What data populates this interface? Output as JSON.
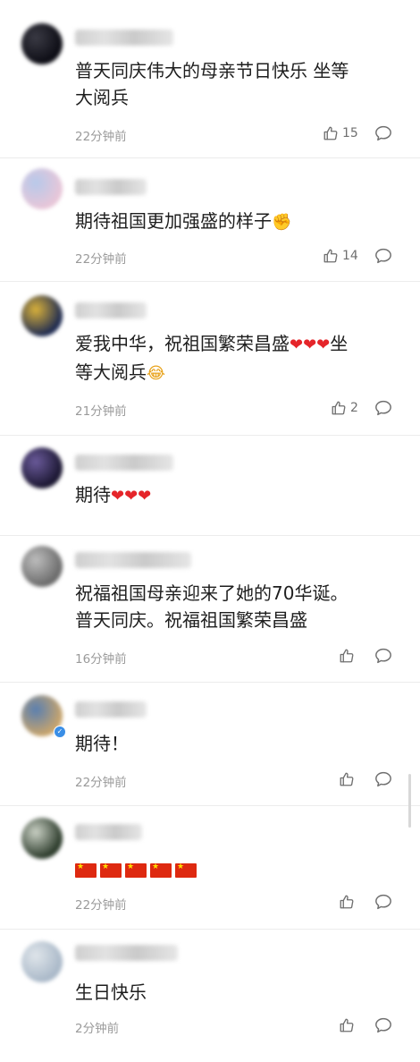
{
  "comments": [
    {
      "text": "普天同庆伟大的母亲节日快乐 坐等\n大阅兵",
      "time": "22分钟前",
      "likes": "15",
      "avatar_colors": [
        "#0c0c14",
        "#3a3a44"
      ],
      "verified": false
    },
    {
      "text": "期待祖国更加强盛的样子",
      "emoji": "✊",
      "time": "22分钟前",
      "likes": "14",
      "avatar_colors": [
        "#e8c6d8",
        "#b7c9ea"
      ],
      "verified": false
    },
    {
      "text": "爱我中华，祝祖国繁荣昌盛",
      "emoji": "❤❤❤",
      "text_after": "坐\n等大阅兵",
      "emoji_after": "😂",
      "time": "21分钟前",
      "likes": "2",
      "avatar_colors": [
        "#1d2a52",
        "#d9b13a"
      ],
      "verified": false
    },
    {
      "text": "期待",
      "emoji": "❤❤❤",
      "time": "",
      "likes": "",
      "avatar_colors": [
        "#1a1630",
        "#6a5a9a"
      ],
      "verified": false
    },
    {
      "text": "祝福祖国母亲迎来了她的70华诞。\n普天同庆。祝福祖国繁荣昌盛",
      "time": "16分钟前",
      "likes": "",
      "avatar_colors": [
        "#6a6a6a",
        "#bdbdbd"
      ],
      "verified": false
    },
    {
      "text": "期待！",
      "time": "22分钟前",
      "likes": "",
      "avatar_colors": [
        "#c9a56c",
        "#5a7fb0"
      ],
      "verified": true
    },
    {
      "text": "",
      "flags": 5,
      "time": "22分钟前",
      "likes": "",
      "avatar_colors": [
        "#2b3a2a",
        "#c9d0c4"
      ],
      "verified": false
    },
    {
      "text": "生日快乐",
      "time": "2分钟前",
      "likes": "",
      "avatar_colors": [
        "#a9b8c8",
        "#dfe5ea"
      ],
      "verified": false
    }
  ],
  "icons": {
    "like": "thumbs-up-icon",
    "reply": "speech-bubble-icon",
    "flag": "china-flag-emoji",
    "heart": "red-heart-emoji",
    "laugh": "laughing-emoji",
    "fist": "fist-emoji"
  },
  "colors": {
    "time": "#9a9a9a",
    "divider": "#ececec",
    "heart": "#e5252a",
    "flag": "#de2910"
  }
}
